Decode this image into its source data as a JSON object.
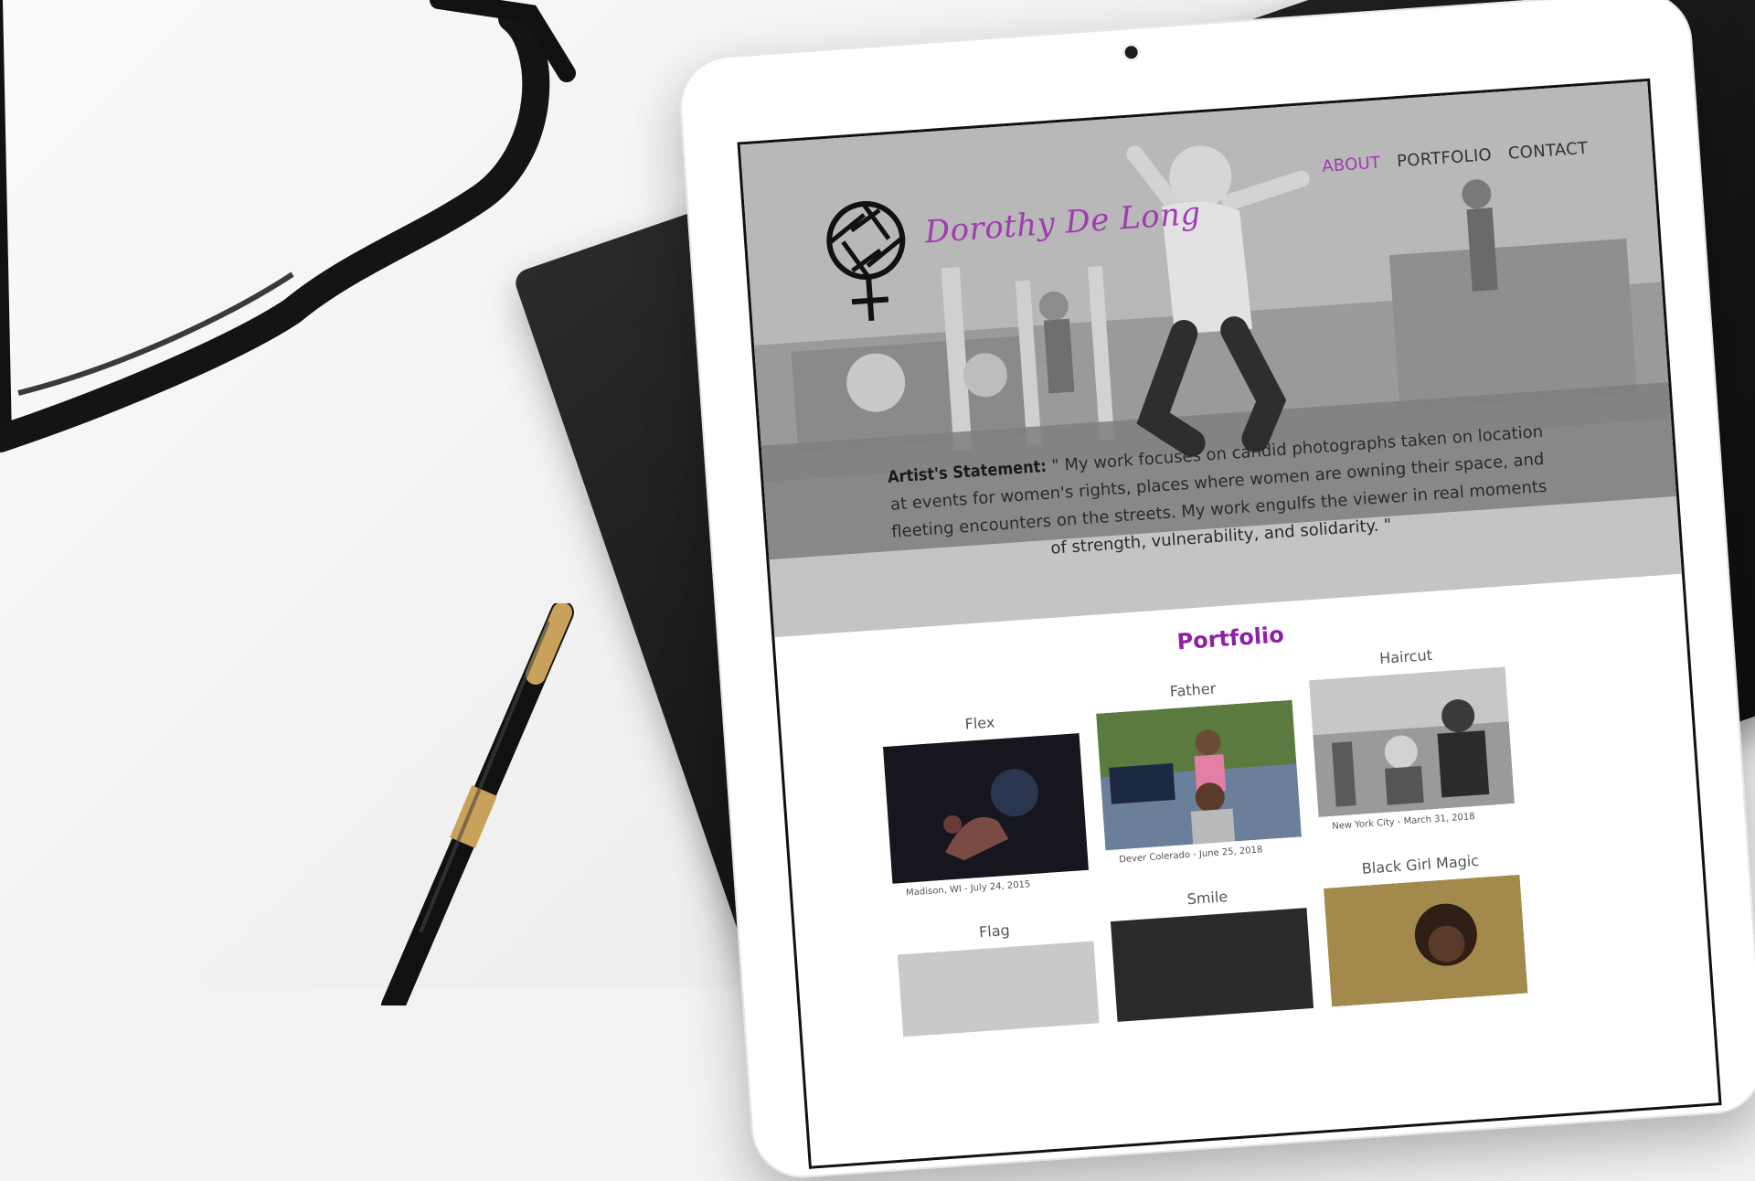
{
  "site": {
    "brand": "Dorothy De Long",
    "nav": [
      {
        "label": "ABOUT",
        "active": true
      },
      {
        "label": "PORTFOLIO",
        "active": false
      },
      {
        "label": "CONTACT",
        "active": false
      }
    ]
  },
  "hero": {
    "statement_label": "Artist's Statement:",
    "statement_text": "\" My work focuses on candid photographs taken on location at events for women's rights, places where women are owning their space, and fleeting encounters on the streets. My work engulfs the viewer in real moments of strength, vulnerability, and solidarity. \""
  },
  "portfolio": {
    "title": "Portfolio",
    "items": [
      {
        "title": "Flex",
        "caption": "Madison, WI - July 24, 2015"
      },
      {
        "title": "Father",
        "caption": "Dever Colerado - June 25, 2018"
      },
      {
        "title": "Haircut",
        "caption": "New York City - March 31, 2018"
      },
      {
        "title": "Flag",
        "caption": ""
      },
      {
        "title": "Smile",
        "caption": ""
      },
      {
        "title": "Black Girl Magic",
        "caption": ""
      }
    ]
  },
  "colors": {
    "brand_purple": "#a23ab3",
    "portfolio_title": "#8f1fa4"
  }
}
